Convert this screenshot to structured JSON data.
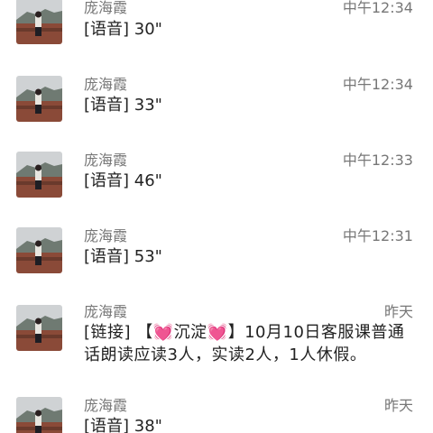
{
  "messages": [
    {
      "sender": "庞海霞",
      "time": "中午12:34",
      "preview": "[语音] 30\""
    },
    {
      "sender": "庞海霞",
      "time": "中午12:34",
      "preview": "[语音] 33\""
    },
    {
      "sender": "庞海霞",
      "time": "中午12:33",
      "preview": "[语音] 46\""
    },
    {
      "sender": "庞海霞",
      "time": "中午12:31",
      "preview": "[语音] 53\""
    },
    {
      "sender": "庞海霞",
      "time": "昨天",
      "preview": "[链接] 【💓沉淀💓】10月10日客服课普通话朗读应读3人，实读2人，1人休假。"
    },
    {
      "sender": "庞海霞",
      "time": "昨天",
      "preview": "[语音] 38\""
    }
  ],
  "colors": {
    "background": "#ffffff",
    "meta_text": "#777777",
    "preview_text": "#222222"
  },
  "icons": {
    "avatar": "landscape-photo-avatar"
  }
}
